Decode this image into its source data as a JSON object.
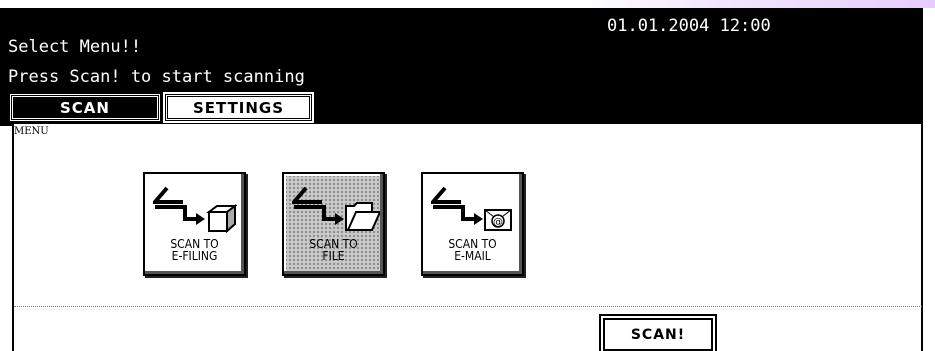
{
  "header": {
    "datetime": "01.01.2004 12:00",
    "message_line1": "Select Menu!!",
    "message_line2": "Press Scan! to start scanning"
  },
  "tabs": {
    "scan": "SCAN",
    "settings": "SETTINGS",
    "active": "scan"
  },
  "panel": {
    "menu_label": "MENU"
  },
  "tiles": [
    {
      "label": "SCAN TO\nE-FILING",
      "icon": "scanner-to-box-icon",
      "selected": false
    },
    {
      "label": "SCAN TO\nFILE",
      "icon": "scanner-to-folder-icon",
      "selected": true
    },
    {
      "label": "SCAN TO\nE-MAIL",
      "icon": "scanner-to-email-icon",
      "selected": false
    }
  ],
  "actions": {
    "scan_button": "SCAN!"
  }
}
